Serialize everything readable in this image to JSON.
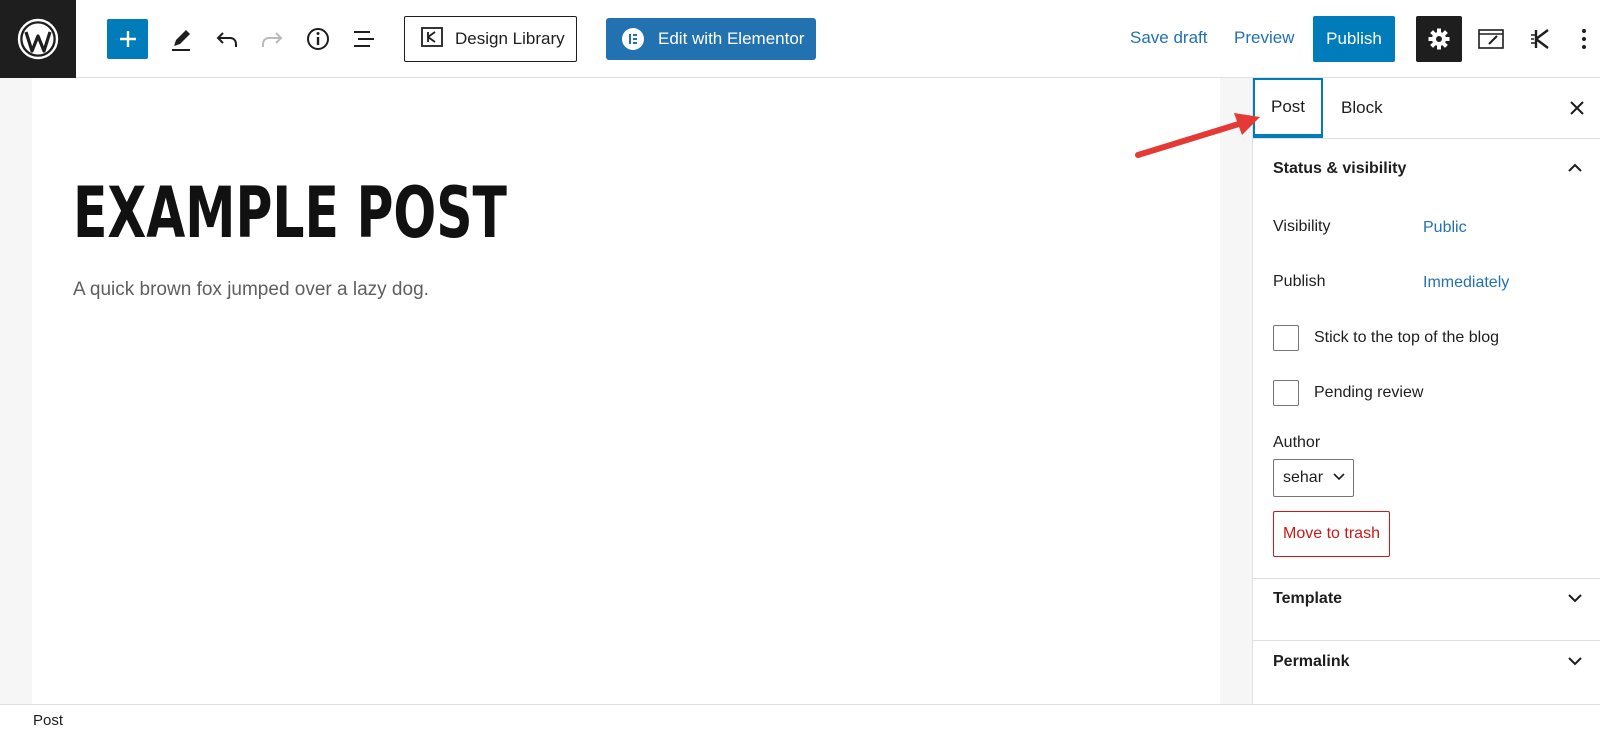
{
  "toolbar": {
    "design_library_label": "Design Library",
    "elementor_label": "Edit with Elementor",
    "save_draft_label": "Save draft",
    "preview_label": "Preview",
    "publish_label": "Publish"
  },
  "post": {
    "title": "EXAMPLE POST",
    "excerpt": "A quick brown fox jumped over a lazy dog."
  },
  "sidebar": {
    "tabs": [
      {
        "label": "Post",
        "active": true
      },
      {
        "label": "Block",
        "active": false
      }
    ],
    "status_visibility": {
      "heading": "Status & visibility",
      "visibility_label": "Visibility",
      "visibility_value": "Public",
      "publish_label": "Publish",
      "publish_value": "Immediately",
      "stick_label": "Stick to the top of the blog",
      "pending_label": "Pending review",
      "author_label": "Author",
      "author_value": "sehar",
      "trash_label": "Move to trash"
    },
    "template_heading": "Template",
    "permalink_heading": "Permalink"
  },
  "statusbar": {
    "breadcrumb": "Post"
  },
  "colors": {
    "accent": "#007cba",
    "link": "#2271b1",
    "danger": "#cc1818",
    "dark": "#1e1e1e",
    "annotation": "#e53935"
  }
}
